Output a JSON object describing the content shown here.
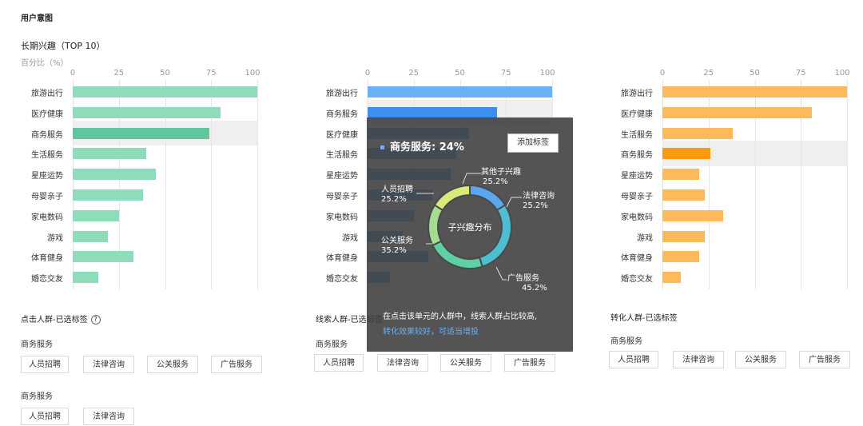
{
  "page": {
    "title": "用户意图",
    "subtitle": "长期兴趣（TOP 10）",
    "unit": "百分比（%）"
  },
  "chart_data": [
    {
      "type": "bar",
      "orientation": "horizontal",
      "xlim": [
        0,
        100
      ],
      "ticks": [
        0,
        25,
        50,
        75,
        100
      ],
      "color": "#8fdcba",
      "highlight_color": "#5fc79e",
      "highlight_index": 2,
      "categories": [
        "旅游出行",
        "医疗健康",
        "商务服务",
        "生活服务",
        "星座运势",
        "母婴亲子",
        "家电数码",
        "游戏",
        "体育健身",
        "婚恋交友"
      ],
      "values": [
        100,
        80,
        74,
        40,
        45,
        38,
        25,
        19,
        33,
        14
      ]
    },
    {
      "type": "bar",
      "orientation": "horizontal",
      "xlim": [
        0,
        100
      ],
      "ticks": [
        0,
        25,
        50,
        75,
        100
      ],
      "color": "#6ab0f5",
      "highlight_color": "#3d8ef0",
      "highlight_index": 1,
      "categories": [
        "旅游出行",
        "商务服务",
        "医疗健康",
        "生活服务",
        "星座运势",
        "母婴亲子",
        "家电数码",
        "游戏",
        "体育健身",
        "婚恋交友"
      ],
      "values": [
        100,
        70,
        55,
        48,
        45,
        35,
        25,
        19,
        33,
        12
      ]
    },
    {
      "type": "bar",
      "orientation": "horizontal",
      "xlim": [
        0,
        100
      ],
      "ticks": [
        0,
        25,
        50,
        75,
        100
      ],
      "color": "#fdb95a",
      "highlight_color": "#fd9a10",
      "highlight_index": 3,
      "categories": [
        "旅游出行",
        "医疗健康",
        "生活服务",
        "商务服务",
        "星座运势",
        "母婴亲子",
        "家电数码",
        "游戏",
        "体育健身",
        "婚恋交友"
      ],
      "values": [
        100,
        81,
        38,
        26,
        20,
        23,
        33,
        23,
        20,
        10
      ]
    }
  ],
  "tooltip": {
    "heading": "商务服务: 24%",
    "button": "添加标签",
    "center": "子兴趣分布",
    "donut": {
      "type": "pie",
      "slices": [
        {
          "name": "法律咨询",
          "pct": "25.2%",
          "value": 25.2,
          "color": "#5aa6f0"
        },
        {
          "name": "广告服务",
          "pct": "45.2%",
          "value": 45.2,
          "color": "#4cbed0"
        },
        {
          "name": "公关服务",
          "pct": "35.2%",
          "value": 35.2,
          "color": "#5dd1a4"
        },
        {
          "name": "人员招聘",
          "pct": "25.2%",
          "value": 25.2,
          "color": "#a5dd90"
        },
        {
          "name": "其他子兴趣",
          "pct": "25.2%",
          "value": 25.2,
          "color": "#d9e97a"
        }
      ]
    },
    "desc1": "在点击该单元的人群中，线索人群占比较高,",
    "desc2": "转化效果较好，可适当增投"
  },
  "sections": {
    "click": {
      "title": "点击人群-已选标签",
      "help": "?",
      "groups": [
        {
          "label": "商务服务",
          "tags": [
            "人员招聘",
            "法律咨询",
            "公关服务",
            "广告服务"
          ]
        },
        {
          "label": "商务服务",
          "tags": [
            "人员招聘",
            "法律咨询"
          ]
        }
      ]
    },
    "lead": {
      "title": "线索人群-已选标签",
      "groups": [
        {
          "label": "商务服务",
          "tags": [
            "人员招聘",
            "法律咨询",
            "公关服务",
            "广告服务"
          ]
        }
      ]
    },
    "convert": {
      "title": "转化人群-已选标签",
      "groups": [
        {
          "label": "商务服务",
          "tags": [
            "人员招聘",
            "法律咨询",
            "公关服务",
            "广告服务"
          ]
        }
      ]
    }
  }
}
